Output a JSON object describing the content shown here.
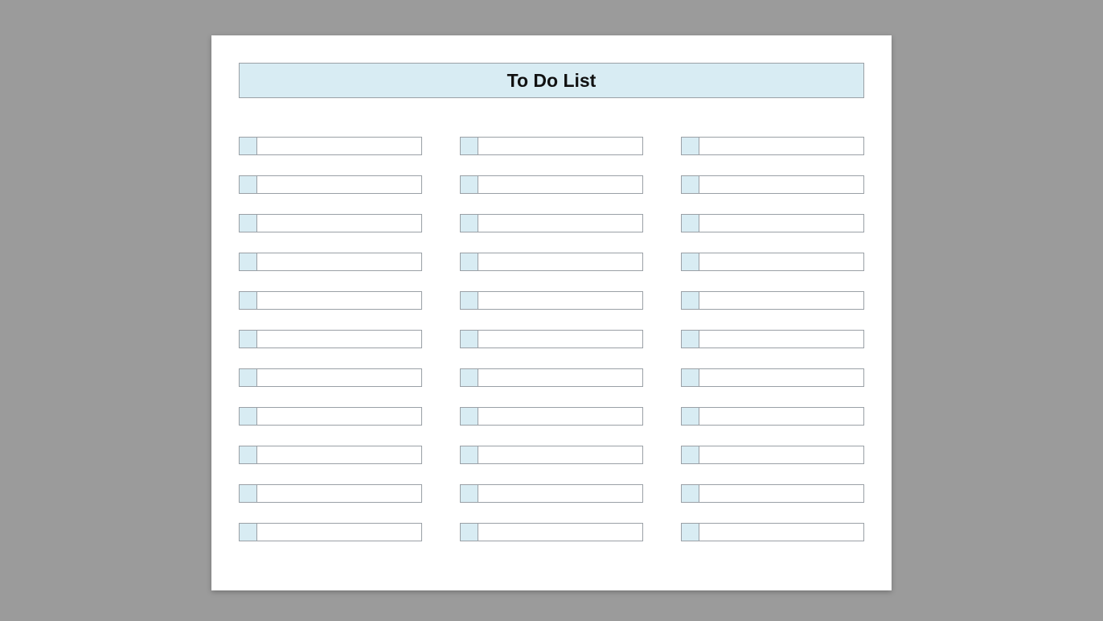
{
  "title": "To Do List",
  "rows": 11,
  "columns": [
    {
      "name": "col1",
      "items": [
        "",
        "",
        "",
        "",
        "",
        "",
        "",
        "",
        "",
        "",
        ""
      ]
    },
    {
      "name": "col2",
      "items": [
        "",
        "",
        "",
        "",
        "",
        "",
        "",
        "",
        "",
        "",
        ""
      ]
    },
    {
      "name": "col3",
      "items": [
        "",
        "",
        "",
        "",
        "",
        "",
        "",
        "",
        "",
        "",
        ""
      ]
    }
  ]
}
